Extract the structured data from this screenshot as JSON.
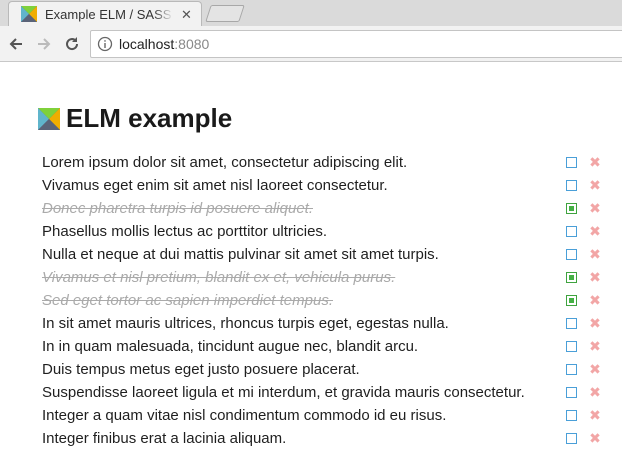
{
  "browser": {
    "tab": {
      "title": "Example ELM / SASS app",
      "close_glyph": "✕",
      "favicon": "elm-logo-icon"
    },
    "address": {
      "host": "localhost",
      "port": ":8080"
    }
  },
  "page": {
    "title": "ELM example",
    "logo": "elm-logo-icon"
  },
  "colors": {
    "checkbox_open": "#4a9fd8",
    "checkbox_done": "#44b044",
    "delete": "#f2a6a6",
    "done_text": "#aaaaaa"
  },
  "todos": [
    {
      "text": "Lorem ipsum dolor sit amet, consectetur adipiscing elit.",
      "done": false
    },
    {
      "text": "Vivamus eget enim sit amet nisl laoreet consectetur.",
      "done": false
    },
    {
      "text": "Donec pharetra turpis id posuere aliquet.",
      "done": true
    },
    {
      "text": "Phasellus mollis lectus ac porttitor ultricies.",
      "done": false
    },
    {
      "text": "Nulla et neque at dui mattis pulvinar sit amet sit amet turpis.",
      "done": false
    },
    {
      "text": "Vivamus et nisl pretium, blandit ex et, vehicula purus.",
      "done": true
    },
    {
      "text": "Sed eget tortor ac sapien imperdiet tempus.",
      "done": true
    },
    {
      "text": "In sit amet mauris ultrices, rhoncus turpis eget, egestas nulla.",
      "done": false
    },
    {
      "text": "In in quam malesuada, tincidunt augue nec, blandit arcu.",
      "done": false
    },
    {
      "text": "Duis tempus metus eget justo posuere placerat.",
      "done": false
    },
    {
      "text": "Suspendisse laoreet ligula et mi interdum, et gravida mauris consectetur.",
      "done": false
    },
    {
      "text": "Integer a quam vitae nisl condimentum commodo id eu risus.",
      "done": false
    },
    {
      "text": "Integer finibus erat a lacinia aliquam.",
      "done": false
    }
  ],
  "delete_glyph": "✖"
}
